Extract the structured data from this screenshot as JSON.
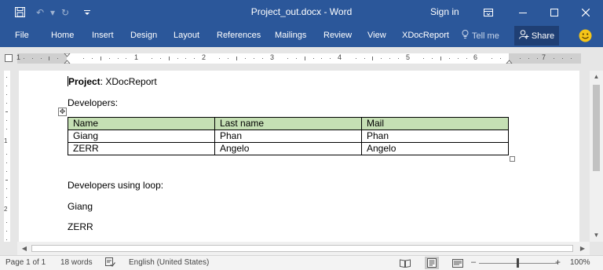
{
  "titlebar": {
    "document_title": "Project_out.docx - Word",
    "sign_in": "Sign in"
  },
  "ribbon": {
    "tabs": [
      {
        "label": "File"
      },
      {
        "label": "Home"
      },
      {
        "label": "Insert"
      },
      {
        "label": "Design"
      },
      {
        "label": "Layout"
      },
      {
        "label": "References"
      },
      {
        "label": "Mailings"
      },
      {
        "label": "Review"
      },
      {
        "label": "View"
      },
      {
        "label": "XDocReport"
      }
    ],
    "tell_me": "Tell me",
    "share": "Share"
  },
  "ruler": {
    "numbers": [
      "1",
      "1",
      "2",
      "3",
      "4",
      "5",
      "6",
      "7"
    ]
  },
  "document": {
    "project_label": "Project",
    "project_value": ": XDocReport",
    "developers_heading": "Developers:",
    "table": {
      "headers": [
        "Name",
        "Last name",
        "Mail"
      ],
      "rows": [
        [
          "Giang",
          "Phan",
          "Phan"
        ],
        [
          "ZERR",
          "Angelo",
          "Angelo"
        ]
      ]
    },
    "loop_heading": "Developers using loop:",
    "loop_items": [
      "Giang",
      "ZERR"
    ]
  },
  "statusbar": {
    "page": "Page 1 of 1",
    "words": "18 words",
    "language": "English (United States)",
    "zoom": "100%"
  },
  "colors": {
    "title_bar": "#2b579a",
    "table_header": "#c5e0b4"
  }
}
